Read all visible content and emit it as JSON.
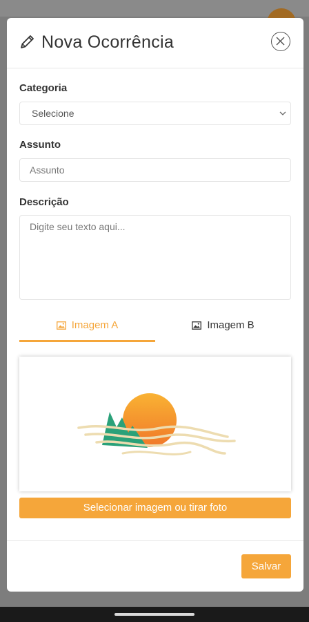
{
  "modal": {
    "title": "Nova Ocorrência",
    "icon": "pencil-icon",
    "close_icon": "close-icon"
  },
  "form": {
    "category": {
      "label": "Categoria",
      "selected": "Selecione"
    },
    "subject": {
      "label": "Assunto",
      "placeholder": "Assunto"
    },
    "description": {
      "label": "Descrição",
      "placeholder": "Digite seu texto aqui..."
    }
  },
  "tabs": [
    {
      "label": "Imagem A",
      "icon": "image-icon",
      "active": true
    },
    {
      "label": "Imagem B",
      "icon": "image-icon",
      "active": false
    }
  ],
  "image_panel": {
    "placeholder_icon": "sunset-landscape-icon"
  },
  "buttons": {
    "select_image": "Selecionar imagem ou tirar foto",
    "save": "Salvar"
  },
  "colors": {
    "accent": "#f5a63a",
    "text": "#333333",
    "sun_top": "#f9b233",
    "sun_bottom": "#f0782a",
    "mountain": "#2aa179"
  }
}
